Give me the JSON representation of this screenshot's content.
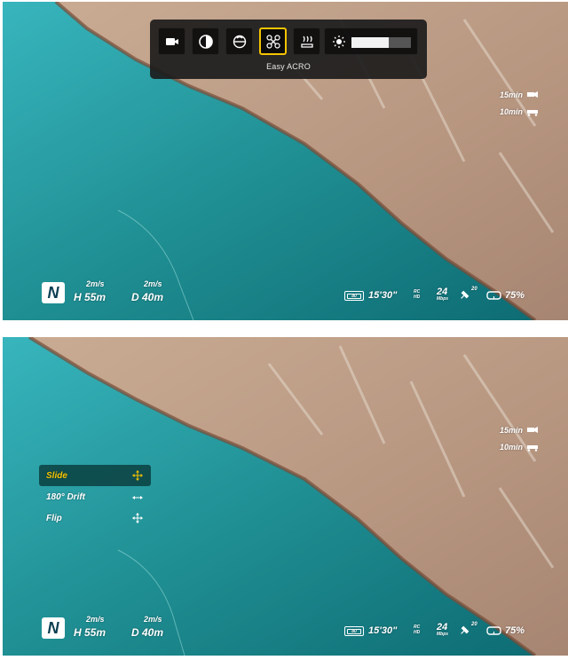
{
  "toolbar": {
    "buttons": [
      {
        "name": "video-camera-icon"
      },
      {
        "name": "contrast-icon"
      },
      {
        "name": "gimbal-icon"
      },
      {
        "name": "acro-drone-icon",
        "active": true
      },
      {
        "name": "heat-icon"
      }
    ],
    "brightness_level": 0.62,
    "caption": "Easy ACRO"
  },
  "telemetry": {
    "compass": "N",
    "h_speed": "2m/s",
    "h_label": "H 55m",
    "d_speed": "2m/s",
    "d_label": "D 40m",
    "timer_1": "15min",
    "timer_2": "10min"
  },
  "status": {
    "battery_label": "80",
    "flight_time": "15'30\"",
    "rc_label": "RC",
    "hd_label": "HD",
    "bitrate": "24",
    "bitrate_unit": "Mbps",
    "satellites": "20",
    "goggle_battery": "75%"
  },
  "menu": {
    "items": [
      {
        "label": "Slide",
        "selected": true
      },
      {
        "label": "180° Drift",
        "selected": false
      },
      {
        "label": "Flip",
        "selected": false
      }
    ]
  },
  "colors": {
    "accent": "#f5c400",
    "sea": "#1f8f93",
    "land": "#b79680"
  }
}
